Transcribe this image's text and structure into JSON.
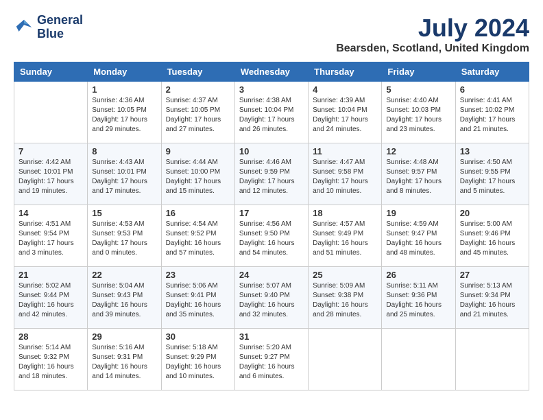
{
  "header": {
    "logo_line1": "General",
    "logo_line2": "Blue",
    "month_title": "July 2024",
    "location": "Bearsden, Scotland, United Kingdom"
  },
  "days_of_week": [
    "Sunday",
    "Monday",
    "Tuesday",
    "Wednesday",
    "Thursday",
    "Friday",
    "Saturday"
  ],
  "weeks": [
    [
      {
        "day": "",
        "info": ""
      },
      {
        "day": "1",
        "info": "Sunrise: 4:36 AM\nSunset: 10:05 PM\nDaylight: 17 hours\nand 29 minutes."
      },
      {
        "day": "2",
        "info": "Sunrise: 4:37 AM\nSunset: 10:05 PM\nDaylight: 17 hours\nand 27 minutes."
      },
      {
        "day": "3",
        "info": "Sunrise: 4:38 AM\nSunset: 10:04 PM\nDaylight: 17 hours\nand 26 minutes."
      },
      {
        "day": "4",
        "info": "Sunrise: 4:39 AM\nSunset: 10:04 PM\nDaylight: 17 hours\nand 24 minutes."
      },
      {
        "day": "5",
        "info": "Sunrise: 4:40 AM\nSunset: 10:03 PM\nDaylight: 17 hours\nand 23 minutes."
      },
      {
        "day": "6",
        "info": "Sunrise: 4:41 AM\nSunset: 10:02 PM\nDaylight: 17 hours\nand 21 minutes."
      }
    ],
    [
      {
        "day": "7",
        "info": "Sunrise: 4:42 AM\nSunset: 10:01 PM\nDaylight: 17 hours\nand 19 minutes."
      },
      {
        "day": "8",
        "info": "Sunrise: 4:43 AM\nSunset: 10:01 PM\nDaylight: 17 hours\nand 17 minutes."
      },
      {
        "day": "9",
        "info": "Sunrise: 4:44 AM\nSunset: 10:00 PM\nDaylight: 17 hours\nand 15 minutes."
      },
      {
        "day": "10",
        "info": "Sunrise: 4:46 AM\nSunset: 9:59 PM\nDaylight: 17 hours\nand 12 minutes."
      },
      {
        "day": "11",
        "info": "Sunrise: 4:47 AM\nSunset: 9:58 PM\nDaylight: 17 hours\nand 10 minutes."
      },
      {
        "day": "12",
        "info": "Sunrise: 4:48 AM\nSunset: 9:57 PM\nDaylight: 17 hours\nand 8 minutes."
      },
      {
        "day": "13",
        "info": "Sunrise: 4:50 AM\nSunset: 9:55 PM\nDaylight: 17 hours\nand 5 minutes."
      }
    ],
    [
      {
        "day": "14",
        "info": "Sunrise: 4:51 AM\nSunset: 9:54 PM\nDaylight: 17 hours\nand 3 minutes."
      },
      {
        "day": "15",
        "info": "Sunrise: 4:53 AM\nSunset: 9:53 PM\nDaylight: 17 hours\nand 0 minutes."
      },
      {
        "day": "16",
        "info": "Sunrise: 4:54 AM\nSunset: 9:52 PM\nDaylight: 16 hours\nand 57 minutes."
      },
      {
        "day": "17",
        "info": "Sunrise: 4:56 AM\nSunset: 9:50 PM\nDaylight: 16 hours\nand 54 minutes."
      },
      {
        "day": "18",
        "info": "Sunrise: 4:57 AM\nSunset: 9:49 PM\nDaylight: 16 hours\nand 51 minutes."
      },
      {
        "day": "19",
        "info": "Sunrise: 4:59 AM\nSunset: 9:47 PM\nDaylight: 16 hours\nand 48 minutes."
      },
      {
        "day": "20",
        "info": "Sunrise: 5:00 AM\nSunset: 9:46 PM\nDaylight: 16 hours\nand 45 minutes."
      }
    ],
    [
      {
        "day": "21",
        "info": "Sunrise: 5:02 AM\nSunset: 9:44 PM\nDaylight: 16 hours\nand 42 minutes."
      },
      {
        "day": "22",
        "info": "Sunrise: 5:04 AM\nSunset: 9:43 PM\nDaylight: 16 hours\nand 39 minutes."
      },
      {
        "day": "23",
        "info": "Sunrise: 5:06 AM\nSunset: 9:41 PM\nDaylight: 16 hours\nand 35 minutes."
      },
      {
        "day": "24",
        "info": "Sunrise: 5:07 AM\nSunset: 9:40 PM\nDaylight: 16 hours\nand 32 minutes."
      },
      {
        "day": "25",
        "info": "Sunrise: 5:09 AM\nSunset: 9:38 PM\nDaylight: 16 hours\nand 28 minutes."
      },
      {
        "day": "26",
        "info": "Sunrise: 5:11 AM\nSunset: 9:36 PM\nDaylight: 16 hours\nand 25 minutes."
      },
      {
        "day": "27",
        "info": "Sunrise: 5:13 AM\nSunset: 9:34 PM\nDaylight: 16 hours\nand 21 minutes."
      }
    ],
    [
      {
        "day": "28",
        "info": "Sunrise: 5:14 AM\nSunset: 9:32 PM\nDaylight: 16 hours\nand 18 minutes."
      },
      {
        "day": "29",
        "info": "Sunrise: 5:16 AM\nSunset: 9:31 PM\nDaylight: 16 hours\nand 14 minutes."
      },
      {
        "day": "30",
        "info": "Sunrise: 5:18 AM\nSunset: 9:29 PM\nDaylight: 16 hours\nand 10 minutes."
      },
      {
        "day": "31",
        "info": "Sunrise: 5:20 AM\nSunset: 9:27 PM\nDaylight: 16 hours\nand 6 minutes."
      },
      {
        "day": "",
        "info": ""
      },
      {
        "day": "",
        "info": ""
      },
      {
        "day": "",
        "info": ""
      }
    ]
  ]
}
